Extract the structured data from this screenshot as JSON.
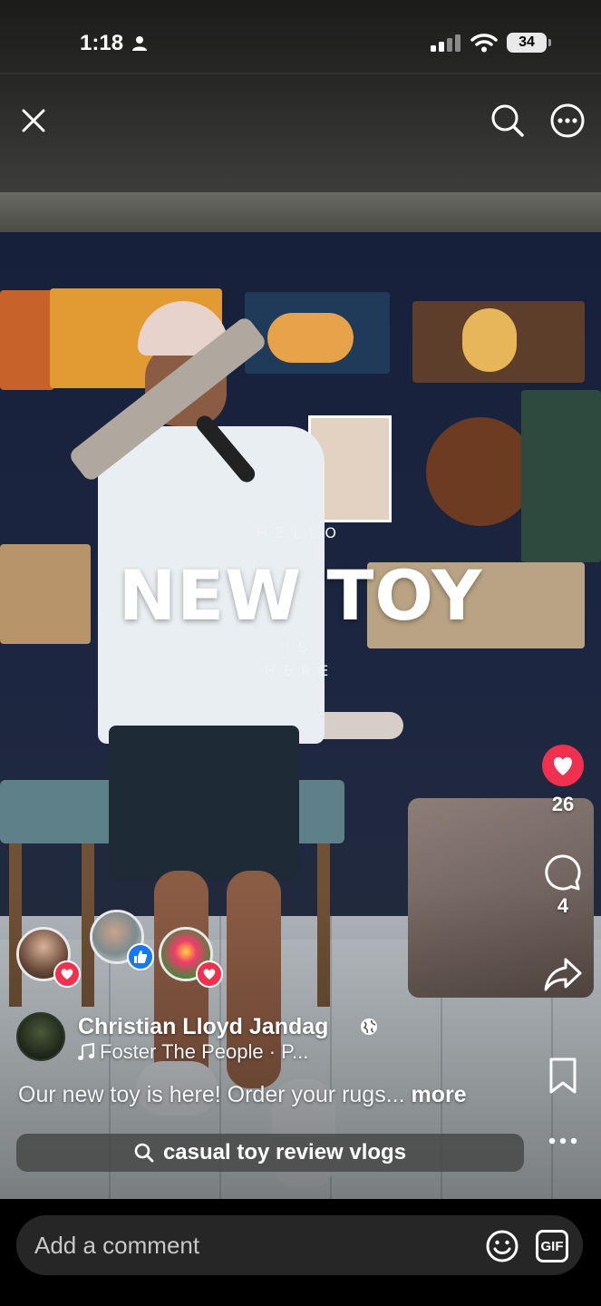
{
  "status_bar": {
    "time": "1:18",
    "battery": "34"
  },
  "overlay": {
    "line1": "HELLO",
    "title": "NEW TOY",
    "line2": "IS",
    "line3": "HERE"
  },
  "actions": {
    "likes": "26",
    "comments": "4"
  },
  "author": {
    "name": "Christian Lloyd Jandag",
    "music": "Foster The People · P..."
  },
  "caption": {
    "text": "Our new toy is here! Order your rugs...",
    "more": "more"
  },
  "search_chip": "casual toy review vlogs",
  "comment": {
    "placeholder": "Add a comment",
    "gif_label": "GIF"
  },
  "colors": {
    "like": "#f0304f",
    "reaction_like": "#1877f2",
    "reaction_love": "#f0304f"
  }
}
